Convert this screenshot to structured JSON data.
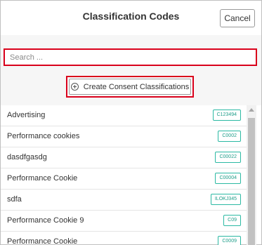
{
  "dialog": {
    "title": "Classification Codes",
    "cancel_label": "Cancel"
  },
  "search": {
    "placeholder": "Search ...",
    "value": ""
  },
  "create_button": {
    "label": "Create Consent Classifications",
    "icon": "plus-circle-icon"
  },
  "items": [
    {
      "name": "Advertising",
      "code": "C123494"
    },
    {
      "name": "Performance cookies",
      "code": "C0002"
    },
    {
      "name": "dasdfgasdg",
      "code": "C00022"
    },
    {
      "name": "Performance Cookie",
      "code": "C00004"
    },
    {
      "name": "sdfa",
      "code": "ILOKJ345"
    },
    {
      "name": "Performance Cookie 9",
      "code": "C09"
    },
    {
      "name": "Performance Cookie",
      "code": "C0009"
    }
  ],
  "colors": {
    "highlight_border": "#d9001b",
    "badge_border": "#2bb9a3",
    "badge_text": "#1f9e8a"
  }
}
